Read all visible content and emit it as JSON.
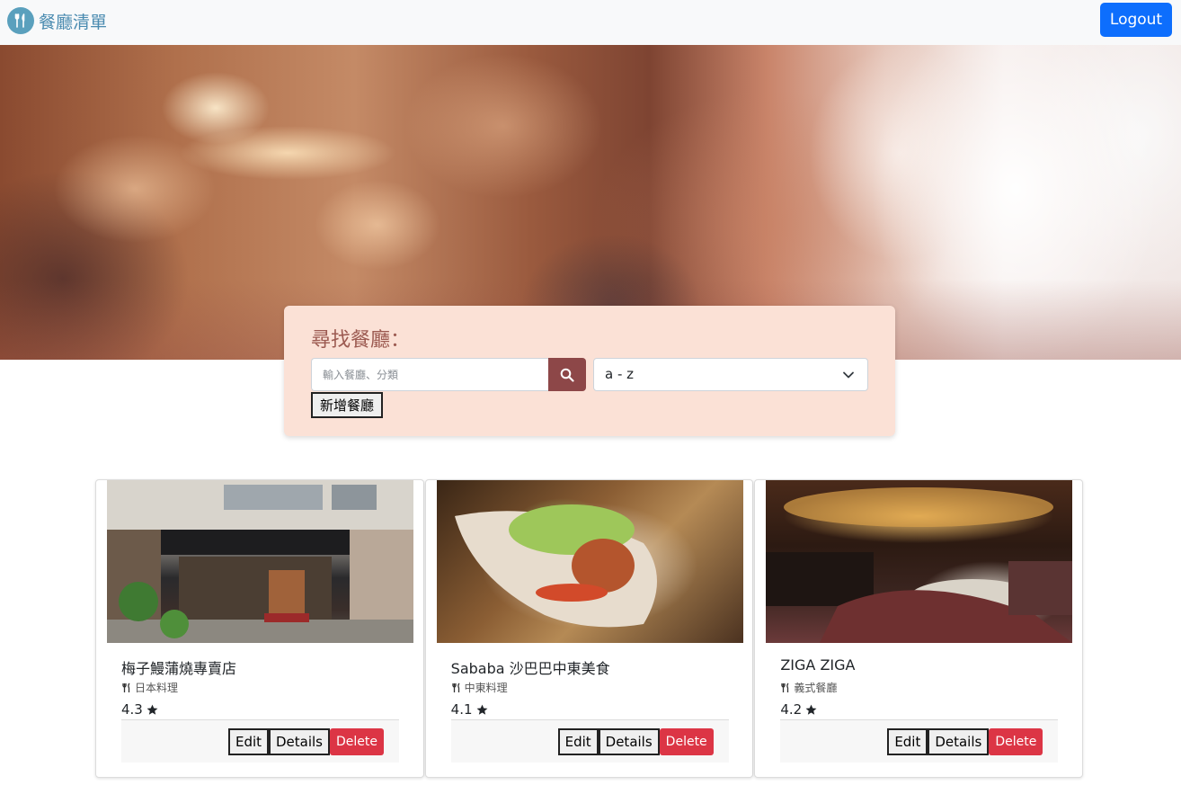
{
  "navbar": {
    "brand_text": "餐廳清單",
    "brand_icon": "utensils-icon",
    "logout_label": "Logout"
  },
  "search": {
    "title": "尋找餐廳：",
    "placeholder": "輸入餐廳、分類",
    "button_icon": "search-icon",
    "sort_value": "a - z",
    "add_label": "新增餐廳"
  },
  "restaurants": [
    {
      "name": "梅子鰻蒲燒專賣店",
      "category": "日本料理",
      "rating": "4.3"
    },
    {
      "name": "Sababa 沙巴巴中東美食",
      "category": "中東料理",
      "rating": "4.1"
    },
    {
      "name": "ZIGA ZIGA",
      "category": "義式餐廳",
      "rating": "4.2"
    }
  ],
  "card_actions": {
    "edit": "Edit",
    "details": "Details",
    "delete": "Delete"
  },
  "colors": {
    "navbar_bg": "#f8f9fa",
    "brand": "#4a8bb0",
    "logout": "#0d6efd",
    "panel_bg": "#fbe1d6",
    "search_btn": "#8d4748",
    "delete": "#dc3545"
  }
}
